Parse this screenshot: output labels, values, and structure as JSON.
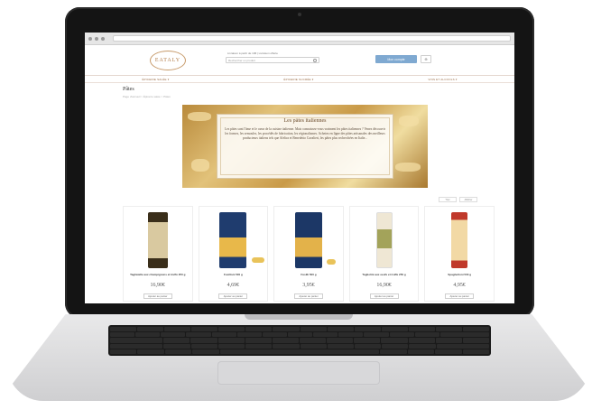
{
  "site": {
    "logo_text": "EATALY",
    "search_hint": "Livraison à partir de 10€ | Livraison offerte",
    "search_placeholder": "Rechercher un produit",
    "account_label": "Mon compte",
    "cart_label": "⊕"
  },
  "nav": {
    "items": [
      "ÉPICERIE SALÉE ▾",
      "ÉPICERIE SUCRÉE ▾",
      "VINS ET ALCOOLS ▾"
    ]
  },
  "page": {
    "title": "Pâtes",
    "breadcrumb": "Page d'accueil > Épicerie salée > Pâtes"
  },
  "banner": {
    "title": "Les pâtes italiennes",
    "text": "Les pâtes sont l'âme et le cœur de la cuisine italienne. Mais connaissez-vous vraiment les pâtes italiennes ? Venez découvrir les formes, les semoules, les procédés de fabrication, les régionalismes. Achetez en ligne des pâtes artisanales des meilleurs producteurs italiens tels que Afeltra et Benedetto Cavalieri, les pâtes plus recherchées en Italie..."
  },
  "filters": [
    "Trier",
    "Afficher"
  ],
  "products": [
    {
      "name": "Tagliatelle aux champignons et truffe 250 g",
      "price": "16,90€",
      "button": "Ajouter au panier",
      "color": "#d9c9a0"
    },
    {
      "name": "Fusilloni 500 g",
      "price": "4,69€",
      "button": "Ajouter au panier",
      "color": "#1f3c6e"
    },
    {
      "name": "Fusilli 500 g",
      "price": "3,95€",
      "button": "Ajouter au panier",
      "color": "#1c3766"
    },
    {
      "name": "Tagliolini aux oeufs et truffe 250 g",
      "price": "16,90€",
      "button": "Ajouter au panier",
      "color": "#efe7d4"
    },
    {
      "name": "Spaghettoni 500 g",
      "price": "4,95€",
      "button": "Ajouter au panier",
      "color": "#f2d9a5"
    }
  ],
  "colors": {
    "accent": "#7fa9d1",
    "brand": "#b17a45"
  }
}
